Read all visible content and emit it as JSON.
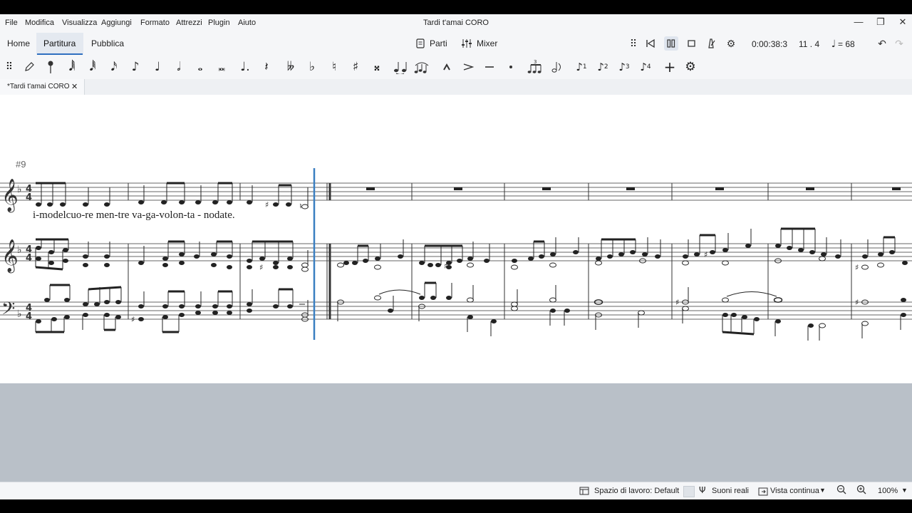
{
  "menu": [
    "File",
    "Modifica",
    "Visualizza",
    "Aggiungi",
    "Formato",
    "Attrezzi",
    "Plugin",
    "Aiuto"
  ],
  "window_title": "Tardi t'amai CORO",
  "window_controls": {
    "minimize": "—",
    "maximize": "❐",
    "close": "✕"
  },
  "nav_tabs": [
    "Home",
    "Partitura",
    "Pubblica"
  ],
  "active_tab": "Partitura",
  "toolbar": {
    "parts_label": "Parti",
    "mixer_label": "Mixer",
    "time_display": "0:00:38:3",
    "position_display": "11 . 4",
    "tempo_display": "= 68"
  },
  "palette_icons": [
    "grip-icon",
    "pencil-icon",
    "pin-icon",
    "64th-note-icon",
    "32nd-note-icon",
    "16th-note-icon",
    "eighth-note-icon",
    "quarter-note-icon",
    "half-note-icon",
    "whole-note-icon",
    "breve-icon",
    "augmentation-dot-icon",
    "rest-icon",
    "double-flat-icon",
    "flat-icon",
    "natural-icon",
    "sharp-icon",
    "double-sharp-icon",
    "tie-icon",
    "slur-icon",
    "marcato-icon",
    "accent-icon",
    "tenuto-icon",
    "staccato-icon",
    "tuplet-icon",
    "flip-icon",
    "voice-1-icon",
    "voice-2-icon",
    "voice-3-icon",
    "voice-4-icon",
    "add-icon",
    "settings-icon"
  ],
  "document_tab": {
    "title": "*Tardi t'amai CORO",
    "close": "✕"
  },
  "score": {
    "measure_number": "#9",
    "lyrics": "i-modelcuo-re  men-tre va-ga-volon-ta - nodate."
  },
  "status": {
    "workspace": "Spazio di lavoro: Default",
    "real_sounds": "Suoni reali",
    "view_mode": "Vista continua",
    "zoom": "100%"
  }
}
